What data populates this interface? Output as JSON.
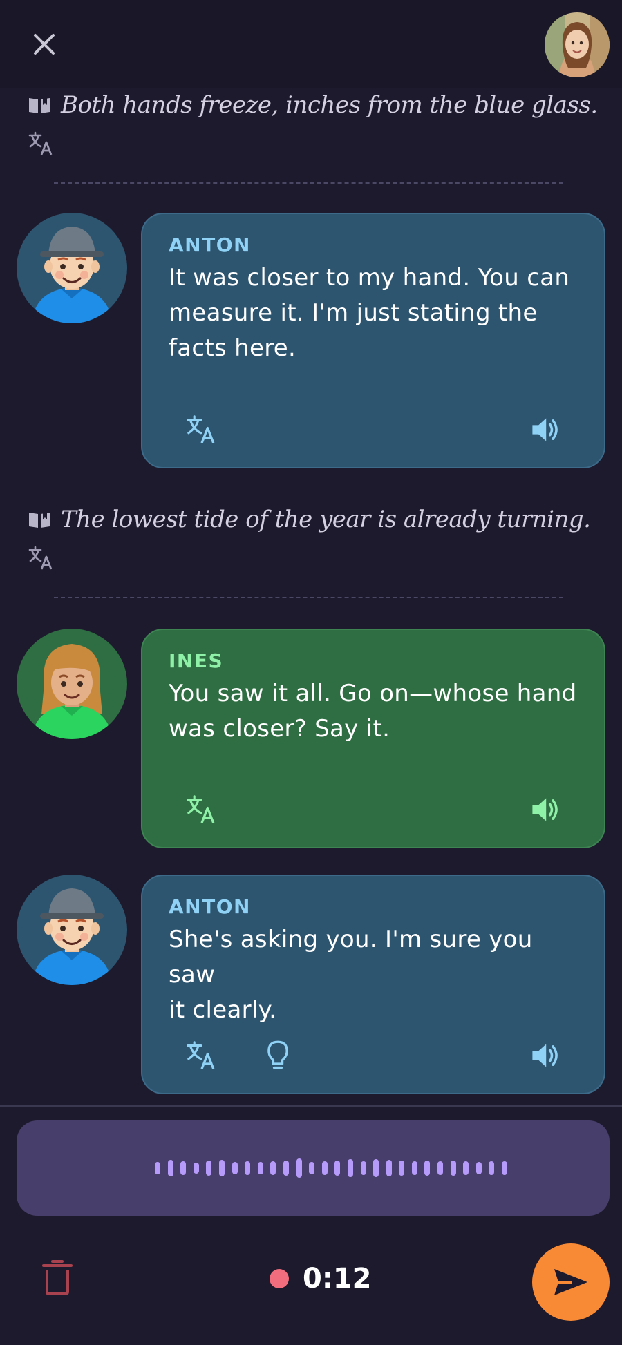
{
  "header": {
    "close_icon": "close-icon",
    "profile_avatar": "user-avatar"
  },
  "narrations": [
    {
      "text": "Both hands freeze, inches from the blue glass.",
      "icon": "book-icon",
      "translate_icon": "translate-icon"
    },
    {
      "text": "The lowest tide of the year is already turning.",
      "icon": "book-icon",
      "translate_icon": "translate-icon"
    }
  ],
  "messages": [
    {
      "speaker": "ANTON",
      "lines": [
        "It was closer to my hand. You can",
        "measure it. I'm just stating the",
        "facts here."
      ],
      "color": "#2e5570"
    },
    {
      "speaker": "INES",
      "lines": [
        "You saw it all. Go on—whose hand",
        "was closer? Say it."
      ],
      "color": "#2f6e42"
    },
    {
      "speaker": "ANTON",
      "lines": [
        "She's asking you. I'm sure you saw",
        "it clearly."
      ],
      "color": "#2e5570"
    }
  ],
  "recorder": {
    "timer": "0:12",
    "status_color": "#f26d7d",
    "send_color": "#f98a35",
    "wave_color": "#b79bfb"
  }
}
